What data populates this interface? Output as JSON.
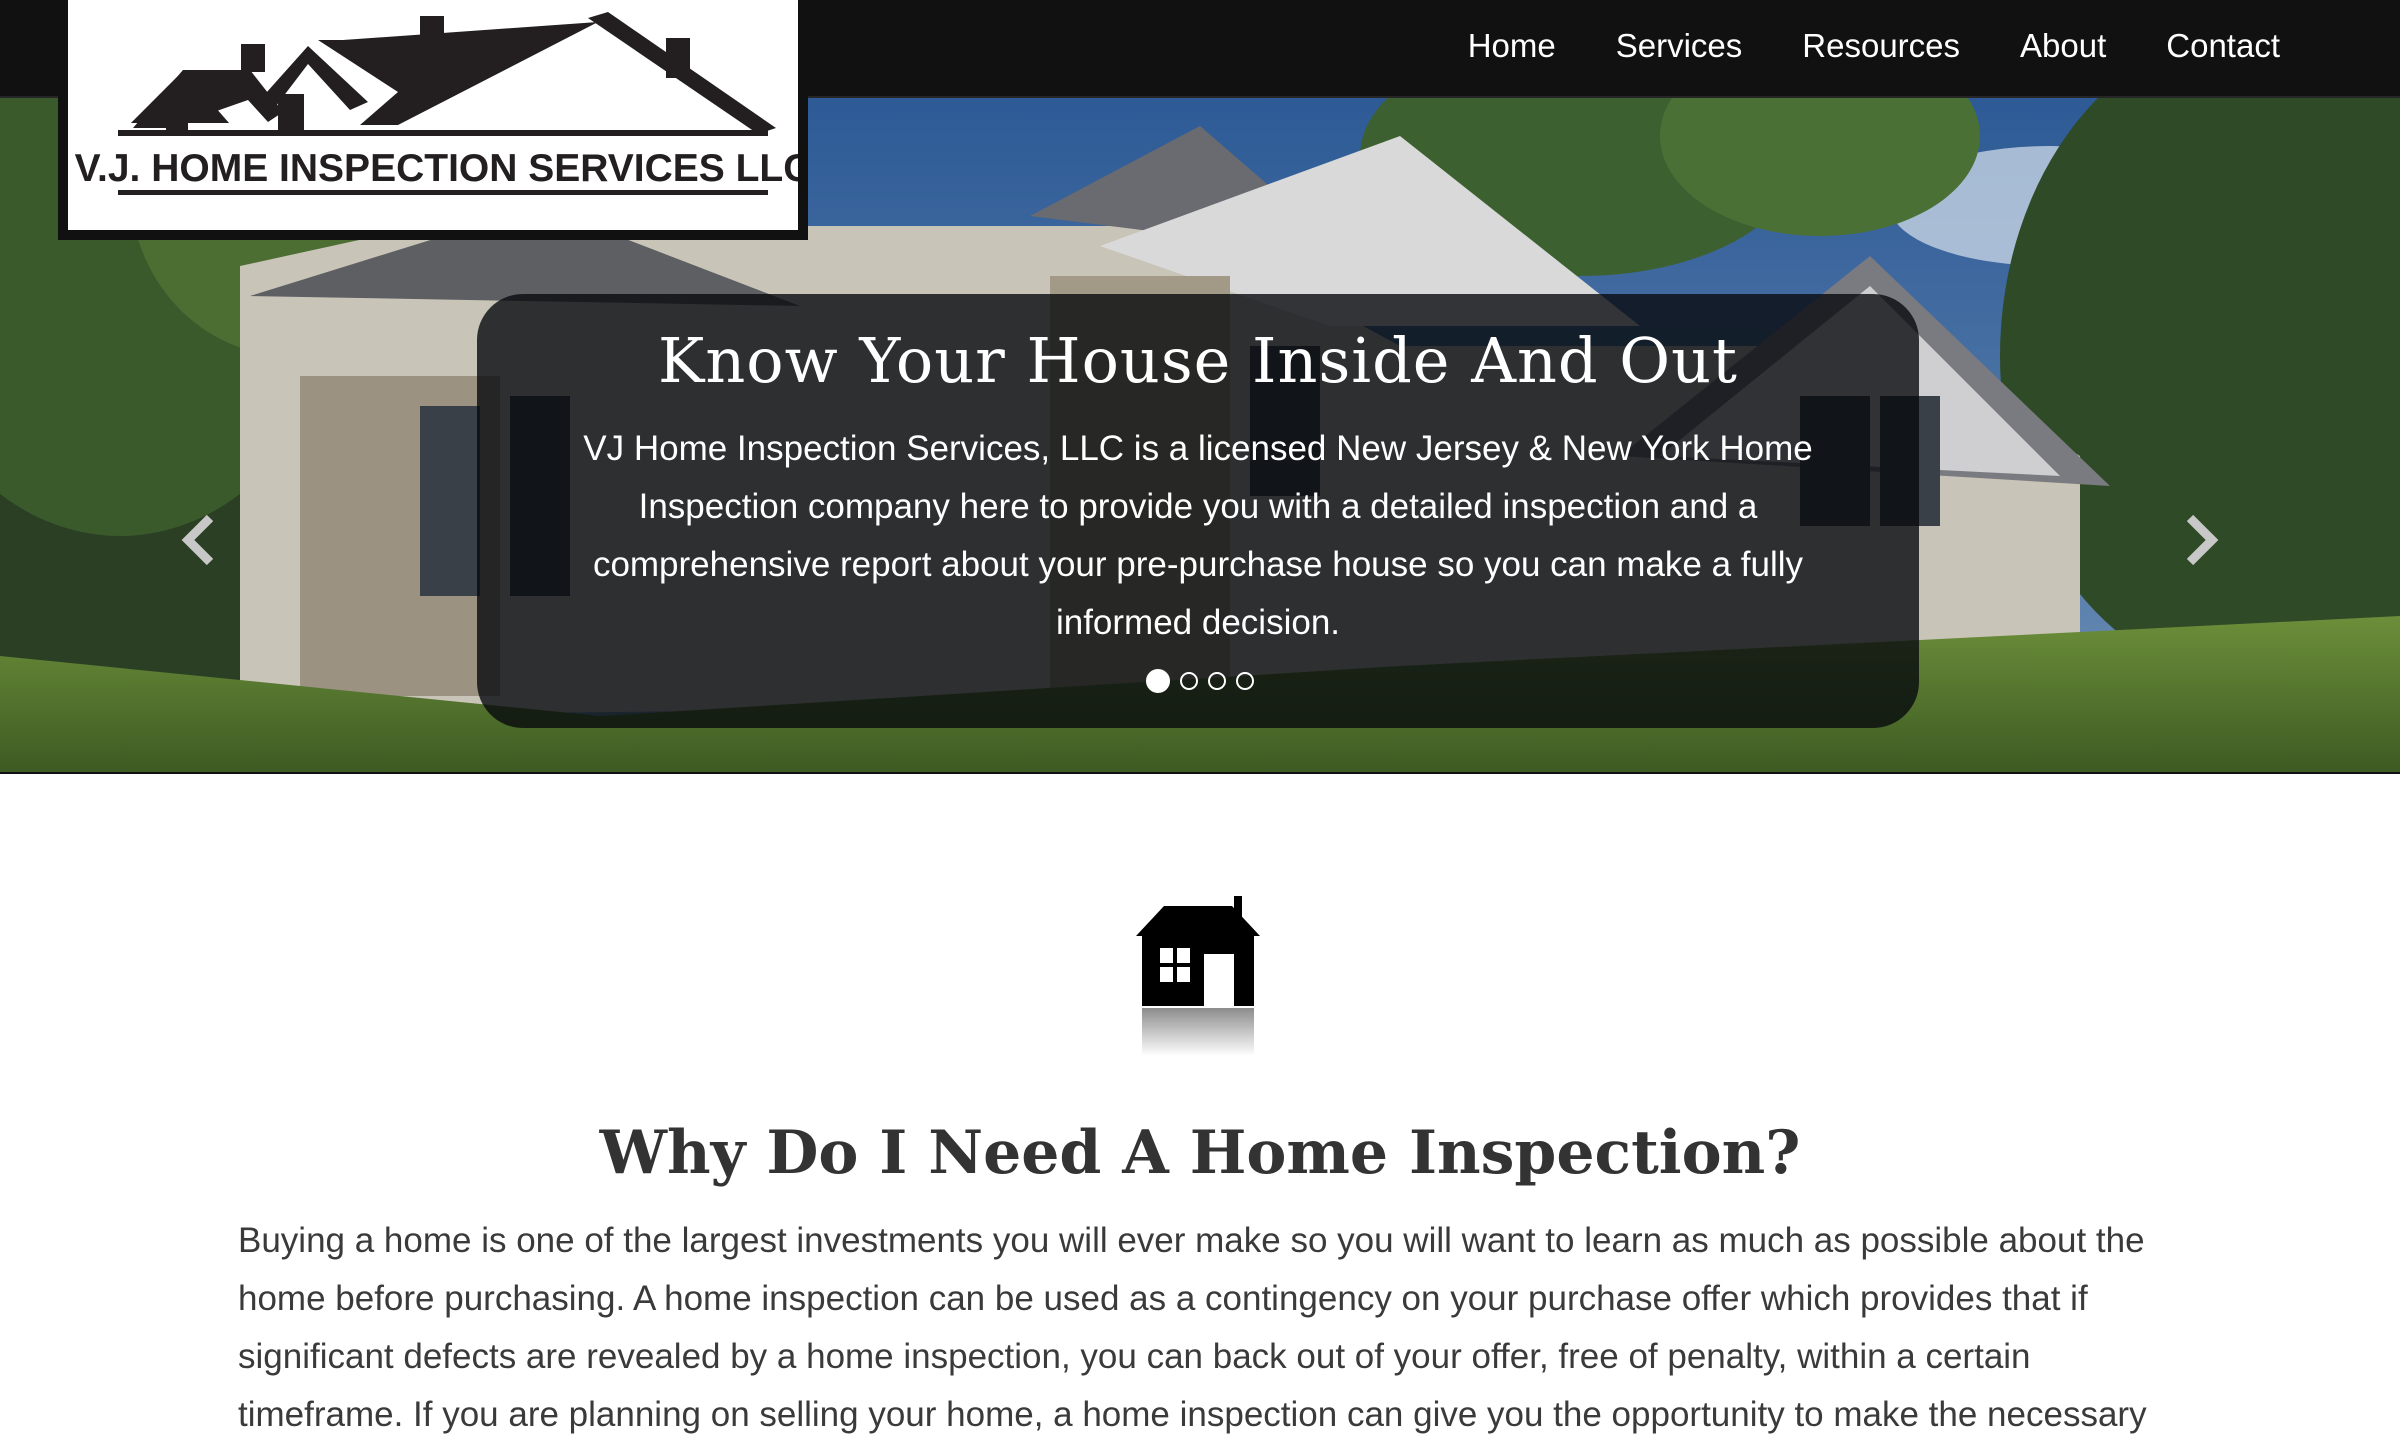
{
  "logo": {
    "text": "V.J. HOME INSPECTION SERVICES LLC"
  },
  "nav": {
    "items": [
      "Home",
      "Services",
      "Resources",
      "About",
      "Contact"
    ]
  },
  "hero": {
    "title": "Know Your House Inside And Out",
    "text": "VJ Home Inspection Services, LLC is a licensed New Jersey & New York Home Inspection company here to provide you with a detailed inspection and a comprehensive report about your pre-purchase house so you can make a fully informed decision.",
    "slide_count": 4,
    "active_slide": 1
  },
  "section": {
    "title": "Why Do I Need A Home Inspection?",
    "body": "Buying a home is one of the largest investments you will ever make so you will want to learn as much as possible about the home before purchasing.  A home inspection can be used as a contingency on your purchase offer which provides that if significant defects are revealed by a home inspection, you can back out of your offer, free of penalty, within a certain timeframe.  If you are planning on selling your home, a home inspection can give you the opportunity to make the necessary"
  },
  "colors": {
    "navbar_bg": "#111111",
    "caption_bg": "rgba(8,10,14,0.80)",
    "text": "#333333"
  },
  "icons": [
    "house-logo-icon",
    "chevron-left-icon",
    "chevron-right-icon",
    "house-icon"
  ]
}
